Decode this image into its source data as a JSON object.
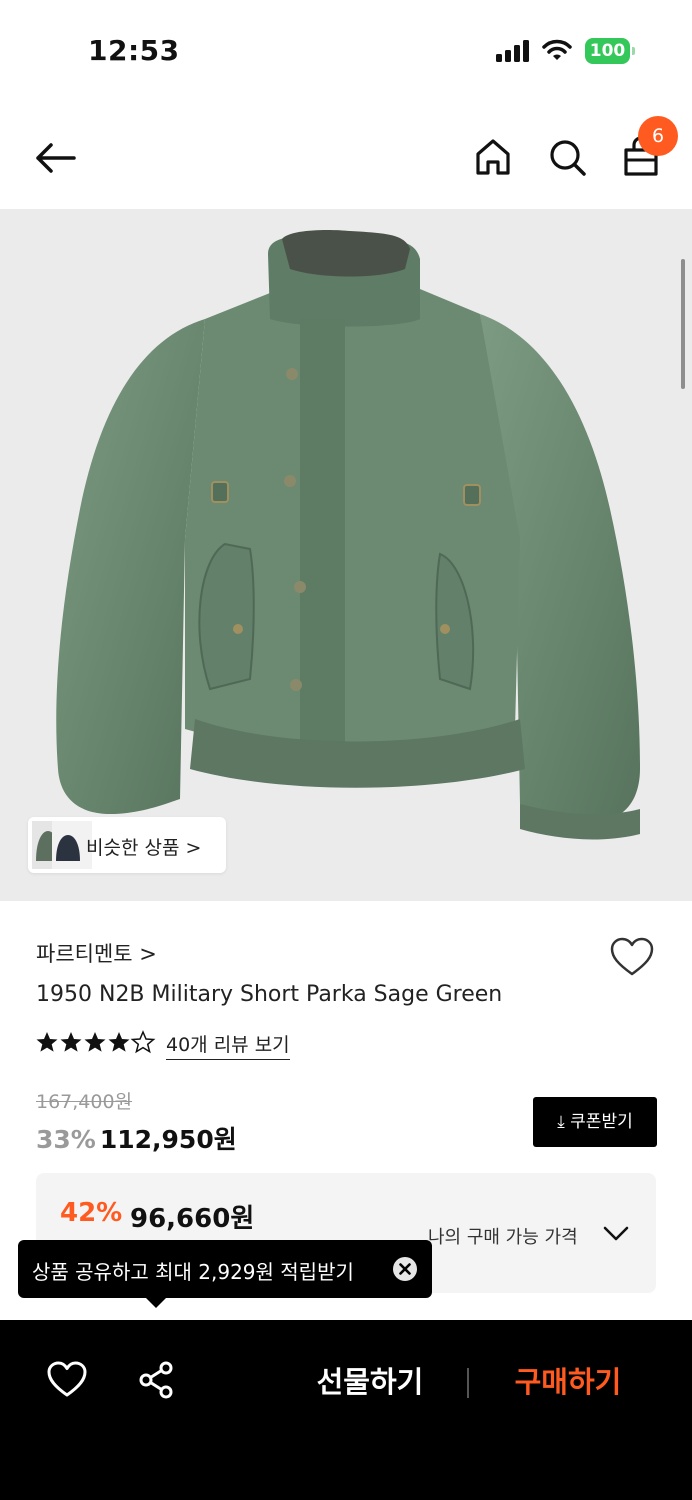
{
  "status_bar": {
    "time": "12:53",
    "battery": "100"
  },
  "header": {
    "back_icon": "arrow-left-icon",
    "home_icon": "home-icon",
    "search_icon": "search-icon",
    "cart_icon": "shopping-bag-icon",
    "cart_count": "6"
  },
  "gallery": {
    "similar_label": "비슷한 상품 >"
  },
  "product": {
    "brand": "파르티멘토 >",
    "name": "1950 N2B Military Short Parka Sage Green",
    "rating": 4.5,
    "review_link": "40개 리뷰 보기",
    "original_price": "167,400원",
    "discount_rate": "33%",
    "sale_price": "112,950원",
    "coupon_label": "⤓ 쿠폰받기"
  },
  "my_price": {
    "discount": "42%",
    "price": "96,660원",
    "label": "나의 구매 가능 가격"
  },
  "tooltip": {
    "text": "상품 공유하고 최대 2,929원 적립받기"
  },
  "bottom_bar": {
    "gift_label": "선물하기",
    "buy_label": "구매하기"
  },
  "colors": {
    "accent": "#ff5a1f",
    "battery": "#34c759",
    "jacket": "#6f8c74"
  }
}
